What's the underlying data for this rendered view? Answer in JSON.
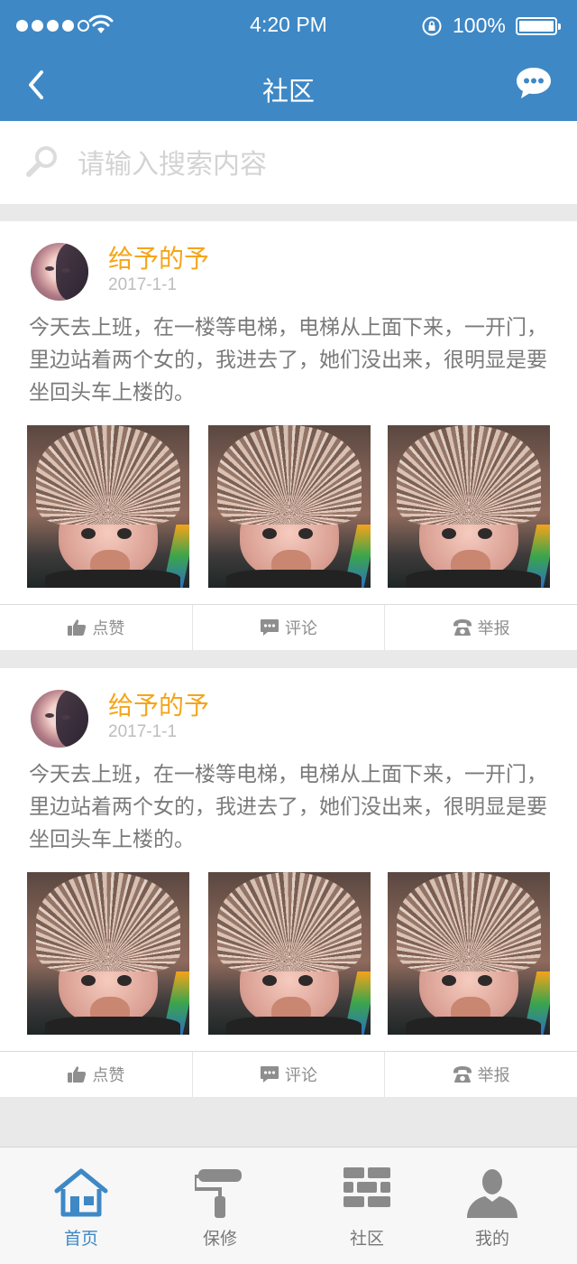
{
  "status_bar": {
    "time": "4:20 PM",
    "battery": "100%"
  },
  "nav": {
    "title": "社区"
  },
  "search": {
    "placeholder": "请输入搜索内容"
  },
  "posts": [
    {
      "author": "给予的予",
      "date": "2017-1-1",
      "content": "今天去上班，在一楼等电梯，电梯从上面下来，一开门，里边站着两个女的，我进去了，她们没出来，很明显是要坐回头车上楼的。",
      "photo_count": 3,
      "actions": {
        "like": "点赞",
        "comment": "评论",
        "report": "举报"
      }
    },
    {
      "author": "给予的予",
      "date": "2017-1-1",
      "content": "今天去上班，在一楼等电梯，电梯从上面下来，一开门，里边站着两个女的，我进去了，她们没出来，很明显是要坐回头车上楼的。",
      "photo_count": 3,
      "actions": {
        "like": "点赞",
        "comment": "评论",
        "report": "举报"
      }
    }
  ],
  "tabs": [
    {
      "label": "首页",
      "icon": "home-icon",
      "active": true
    },
    {
      "label": "保修",
      "icon": "paint-roller-icon",
      "active": false
    },
    {
      "label": "社区",
      "icon": "bricks-icon",
      "active": false
    },
    {
      "label": "我的",
      "icon": "person-icon",
      "active": false
    }
  ],
  "colors": {
    "header": "#3e88c6",
    "author": "#f5a519",
    "active_tab": "#3e88c6"
  }
}
